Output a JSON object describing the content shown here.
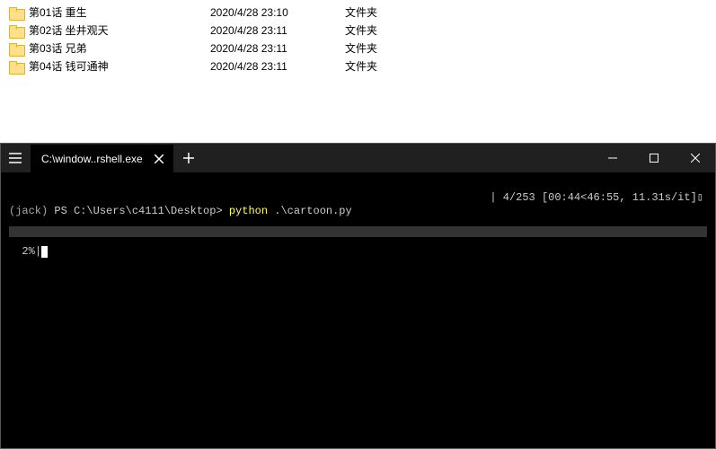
{
  "explorer": {
    "rows": [
      {
        "name": "第01话 重生",
        "date": "2020/4/28 23:10",
        "type": "文件夹"
      },
      {
        "name": "第02话 坐井观天",
        "date": "2020/4/28 23:11",
        "type": "文件夹"
      },
      {
        "name": "第03话 兄弟",
        "date": "2020/4/28 23:11",
        "type": "文件夹"
      },
      {
        "name": "第04话 钱可通神",
        "date": "2020/4/28 23:11",
        "type": "文件夹"
      }
    ]
  },
  "terminal": {
    "tab_title": "C:\\window..rshell.exe",
    "env_name": "(jack)",
    "prompt": "PS C:\\Users\\c4111\\Desktop>",
    "command_bin": "python",
    "command_arg": ".\\cartoon.py",
    "progress_pct": "2%",
    "progress_right": "| 4/253 [00:44<46:55, 11.31s/it]"
  }
}
